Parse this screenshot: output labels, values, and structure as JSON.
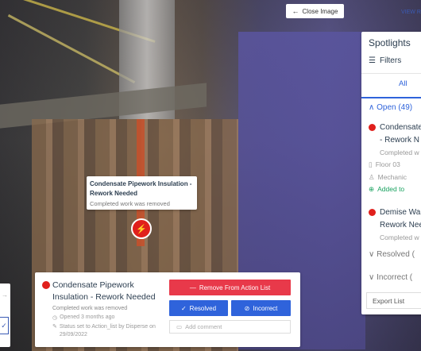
{
  "close_button": {
    "label": "Close Image"
  },
  "view_link": "VIEW R",
  "tooltip": {
    "title": "Condensate Pipework Insulation - Rework Needed",
    "subtitle": "Completed work was removed"
  },
  "detail": {
    "title": "Condensate Pipework Insulation - Rework Needed",
    "subtitle": "Completed work was removed",
    "opened": "Opened 3 months ago",
    "status": "Status set to Action_list by Disperse on 29/09/2022",
    "remove_label": "Remove From Action List",
    "resolved_label": "Resolved",
    "incorrect_label": "Incorrect",
    "comment_placeholder": "Add comment"
  },
  "spotlights": {
    "title": "Spotlights",
    "filters_label": "Filters",
    "tab_all": "All",
    "open_label": "Open (49)",
    "items": [
      {
        "title_line1": "Condensate",
        "title_line2": "- Rework N",
        "subtitle": "Completed w"
      },
      {
        "title_line1": "Demise Wa",
        "title_line2": "Rework Nee",
        "subtitle": "Completed w"
      }
    ],
    "floor": "Floor 03",
    "trade": "Mechanic",
    "added": "Added to",
    "resolved_label": "Resolved (",
    "incorrect_label": "Incorrect (",
    "export_label": "Export List"
  },
  "colors": {
    "accent_blue": "#2f63db",
    "alert_red": "#e0201c",
    "remove_red": "#e8394a",
    "success_green": "#1aa260"
  }
}
